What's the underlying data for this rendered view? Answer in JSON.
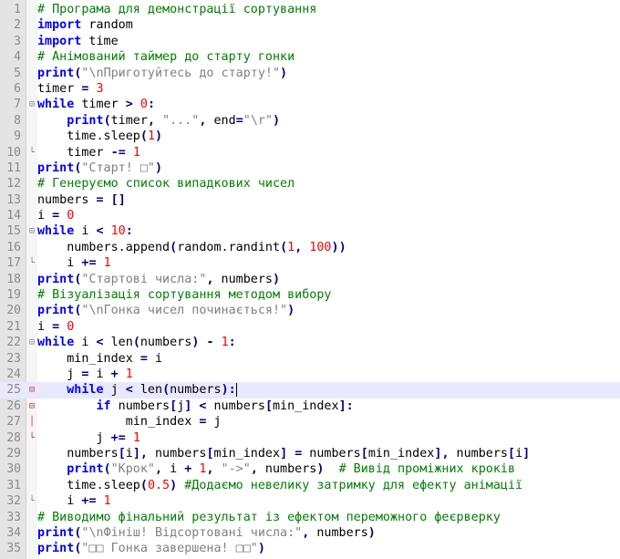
{
  "editor": {
    "language": "python",
    "current_line": 25,
    "lines": [
      "# Програма для демонстрації сортування",
      "import random",
      "import time",
      "# Анімований таймер до старту гонки",
      "print(\"\\nПриготуйтесь до старту!\")",
      "timer = 3",
      "while timer > 0:",
      "    print(timer, \"...\", end=\"\\r\")",
      "    time.sleep(1)",
      "    timer -= 1",
      "print(\"Старт! □\")",
      "# Генеруємо список випадкових чисел",
      "numbers = []",
      "i = 0",
      "while i < 10:",
      "    numbers.append(random.randint(1, 100))",
      "    i += 1",
      "print(\"Стартові числа:\", numbers)",
      "# Візуалізація сортування методом вибору",
      "print(\"\\nГонка чисел починається!\")",
      "i = 0",
      "while i < len(numbers) - 1:",
      "    min_index = i",
      "    j = i + 1",
      "    while j < len(numbers):",
      "        if numbers[j] < numbers[min_index]:",
      "            min_index = j",
      "        j += 1",
      "    numbers[i], numbers[min_index] = numbers[min_index], numbers[i]",
      "    print(\"Крок\", i + 1, \"->\", numbers)  # Вивід проміжних кроків",
      "    time.sleep(0.5) #Додаємо невелику затримку для ефекту анімації",
      "    i += 1",
      "# Виводимо фінальний результат із ефектом переможного феєрверку",
      "print(\"\\nФініш! Відсортовані числа:\", numbers)",
      "print(\"□□ Гонка завершена! □□\")"
    ],
    "fold_markers": {
      "7": "open",
      "10": "end",
      "15": "open",
      "17": "end",
      "22": "open",
      "25": "open-red",
      "26": "open-red",
      "27": "line-red",
      "28": "end-red",
      "32": "end"
    },
    "colors": {
      "keyword": "#0000ff",
      "comment": "#008000",
      "string": "#808080",
      "number": "#ff0000",
      "current_line_bg": "#e8e8ff",
      "gutter_bg": "#e4e4e4"
    },
    "icons": {
      "fold_open": "box-minus-icon",
      "fold_end": "fold-end-icon"
    }
  }
}
